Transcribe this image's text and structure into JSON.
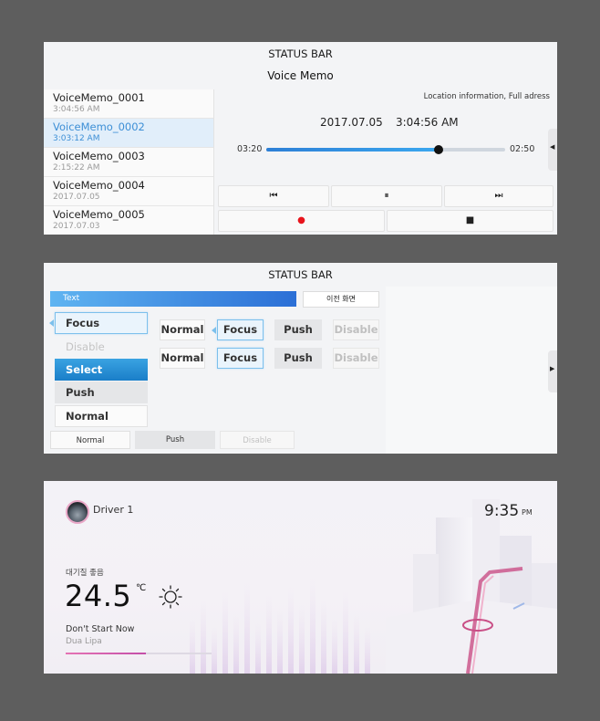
{
  "voice_memo": {
    "status_bar": "STATUS BAR",
    "title": "Voice Memo",
    "items": [
      {
        "name": "VoiceMemo_0001",
        "time": "3:04:56 AM"
      },
      {
        "name": "VoiceMemo_0002",
        "time": "3:03:12 AM"
      },
      {
        "name": "VoiceMemo_0003",
        "time": "2:15:22 AM"
      },
      {
        "name": "VoiceMemo_0004",
        "time": "2017.07.05"
      },
      {
        "name": "VoiceMemo_0005",
        "time": "2017.07.03"
      }
    ],
    "selected_index": 1,
    "location": "Location information, Full adress",
    "date": "2017.07.05",
    "clock": "3:04:56 AM",
    "current_time": "03:20",
    "total_time": "02:50",
    "progress": 0.72,
    "controls": {
      "prev": "⏮",
      "pause": "⏸",
      "next": "⏭",
      "record": "●",
      "stop": "■"
    },
    "colors": {
      "accent": "#2d7fd6",
      "record": "#e8141c"
    }
  },
  "components": {
    "status_bar": "STATUS BAR",
    "text_bar": "Text",
    "prev_screen": "이전 화면",
    "list_states": [
      "Focus",
      "Disable",
      "Select",
      "Push",
      "Normal"
    ],
    "row1": [
      "Normal",
      "Focus",
      "Push",
      "Disable"
    ],
    "row2": [
      "Normal",
      "Focus",
      "Push",
      "Disable"
    ],
    "bottom_tabs": [
      "Normal",
      "Push",
      "Disable"
    ]
  },
  "home": {
    "driver": "Driver 1",
    "time": "9:35",
    "ampm": "PM",
    "air_quality": "대기질 좋음",
    "temperature": "24.5",
    "temp_unit": "℃",
    "weather_icon": "sun-icon",
    "song": "Don't Start Now",
    "artist": "Dua Lipa",
    "song_progress": 0.55,
    "colors": {
      "accent": "#d9469f"
    }
  }
}
